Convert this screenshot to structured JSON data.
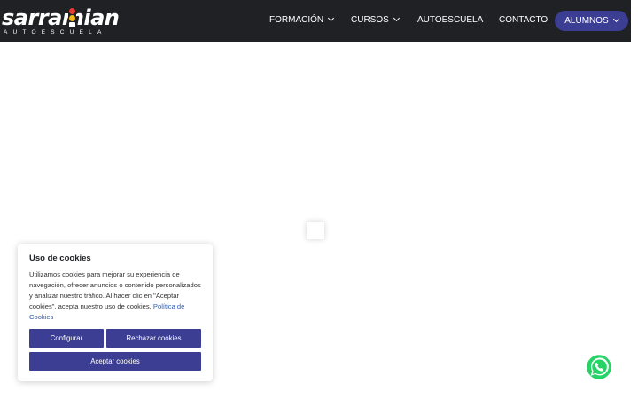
{
  "header": {
    "logo": {
      "text": "sarramian",
      "subtitle": "AUTOESCUELA"
    },
    "nav": [
      {
        "label": "FORMACIÓN",
        "has_dropdown": true
      },
      {
        "label": "CURSOS",
        "has_dropdown": true
      },
      {
        "label": "AUTOESCUELA",
        "has_dropdown": false
      },
      {
        "label": "CONTACTO",
        "has_dropdown": false
      }
    ],
    "alumnos": {
      "label": "ALUMNOS",
      "has_dropdown": true
    }
  },
  "cookies": {
    "title": "Uso de cookies",
    "body": "Utilizamos cookies para mejorar su experiencia de navegación, ofrecer anuncios o contenido personalizados y analizar nuestro tráfico. Al hacer clic en \"Aceptar cookies\", acepta nuestro uso de cookies.",
    "policy_link": "Política de Cookies",
    "buttons": {
      "configure": "Configurar",
      "reject": "Rechazar cookies",
      "accept": "Aceptar cookies"
    }
  },
  "icons": {
    "whatsapp": "whatsapp-icon"
  },
  "colors": {
    "header_bg": "#1f2125",
    "accent": "#3b3e93",
    "whatsapp": "#25d366"
  }
}
